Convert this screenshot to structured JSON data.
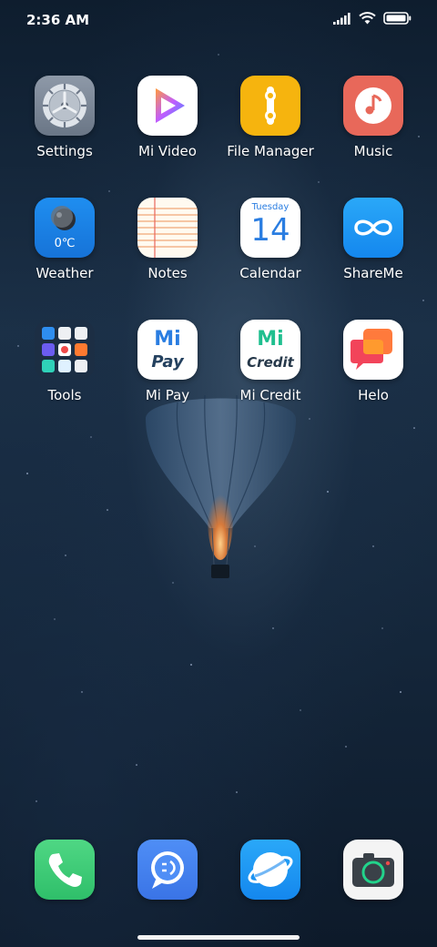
{
  "status": {
    "time": "2:36 AM"
  },
  "apps": [
    {
      "label": "Settings",
      "icon": "settings-icon"
    },
    {
      "label": "Mi Video",
      "icon": "mi-video-icon"
    },
    {
      "label": "File Manager",
      "icon": "file-manager-icon"
    },
    {
      "label": "Music",
      "icon": "music-icon"
    },
    {
      "label": "Weather",
      "icon": "weather-icon",
      "temp": "0℃"
    },
    {
      "label": "Notes",
      "icon": "notes-icon"
    },
    {
      "label": "Calendar",
      "icon": "calendar-icon",
      "weekday": "Tuesday",
      "day": "14"
    },
    {
      "label": "ShareMe",
      "icon": "shareme-icon"
    },
    {
      "label": "Tools",
      "icon": "tools-folder-icon"
    },
    {
      "label": "Mi Pay",
      "icon": "mi-pay-icon",
      "text_top": "Mi",
      "text_bottom": "Pay"
    },
    {
      "label": "Mi Credit",
      "icon": "mi-credit-icon",
      "text_top": "Mi",
      "text_bottom": "Credit"
    },
    {
      "label": "Helo",
      "icon": "helo-icon"
    }
  ],
  "dock": [
    {
      "name": "phone-icon"
    },
    {
      "name": "messages-icon"
    },
    {
      "name": "browser-icon"
    },
    {
      "name": "camera-icon"
    }
  ]
}
